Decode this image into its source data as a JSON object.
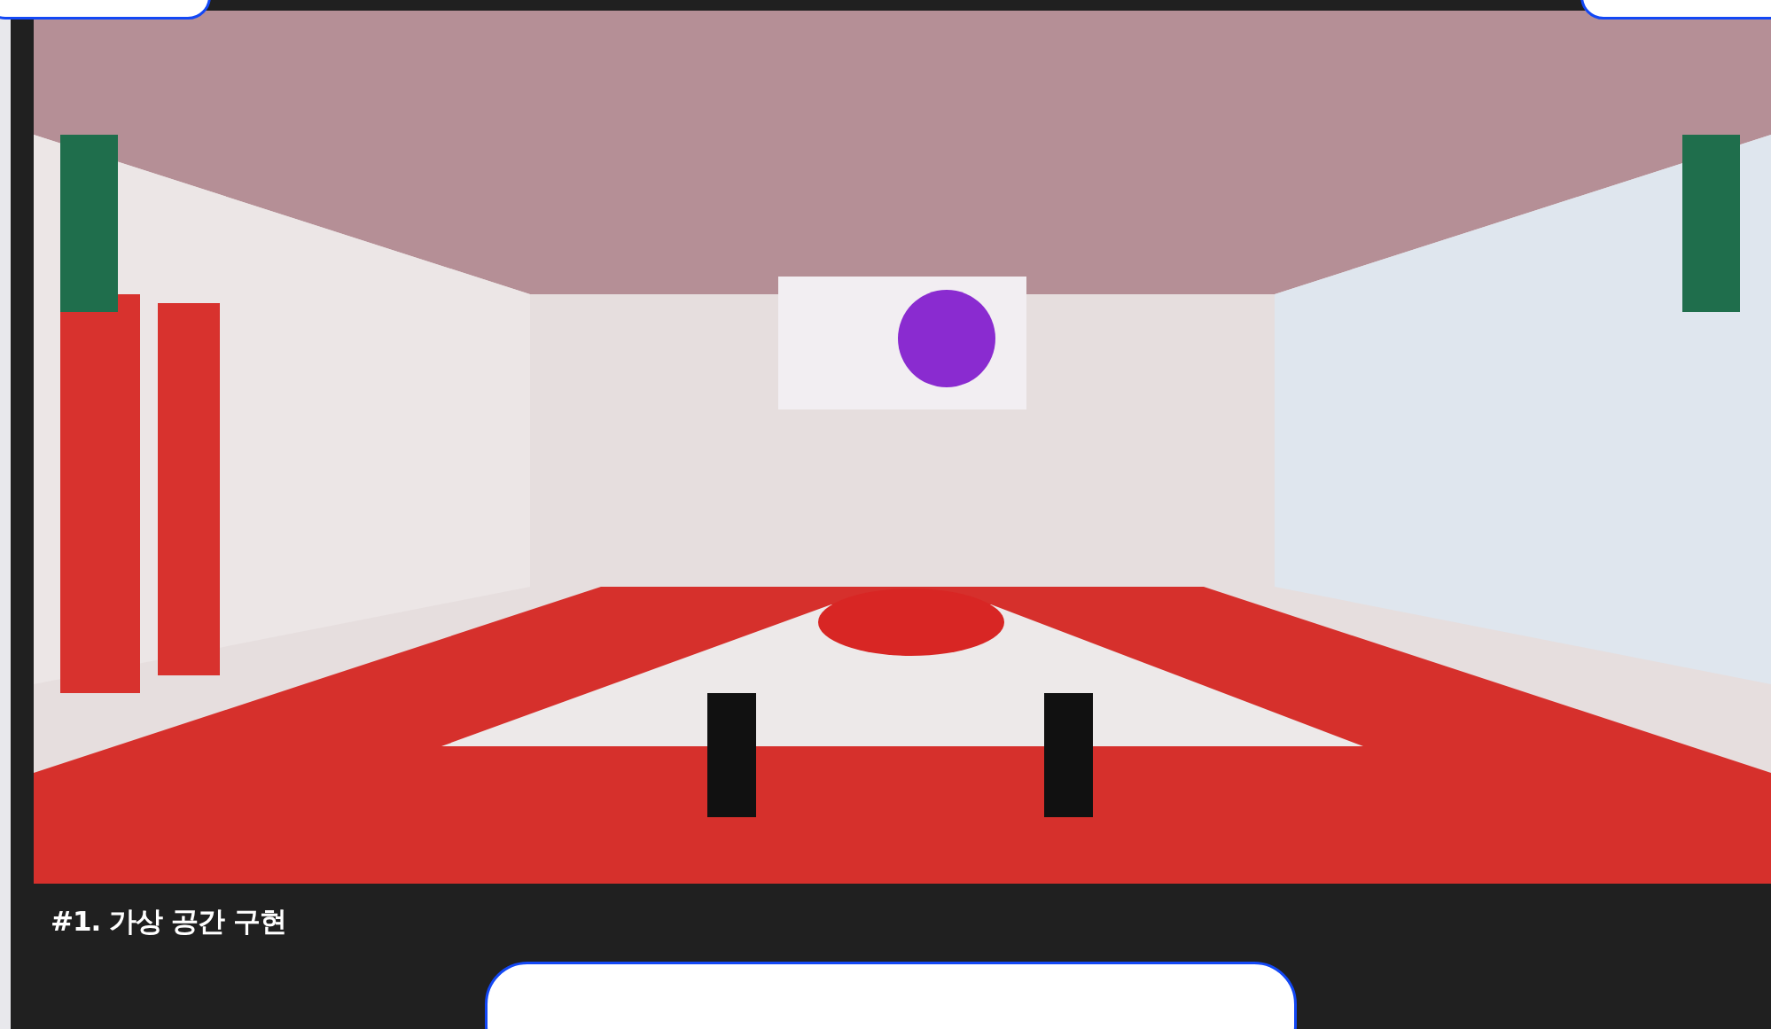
{
  "figure": {
    "kind": "picture",
    "caption": "#1. 가상 공간 구현"
  }
}
